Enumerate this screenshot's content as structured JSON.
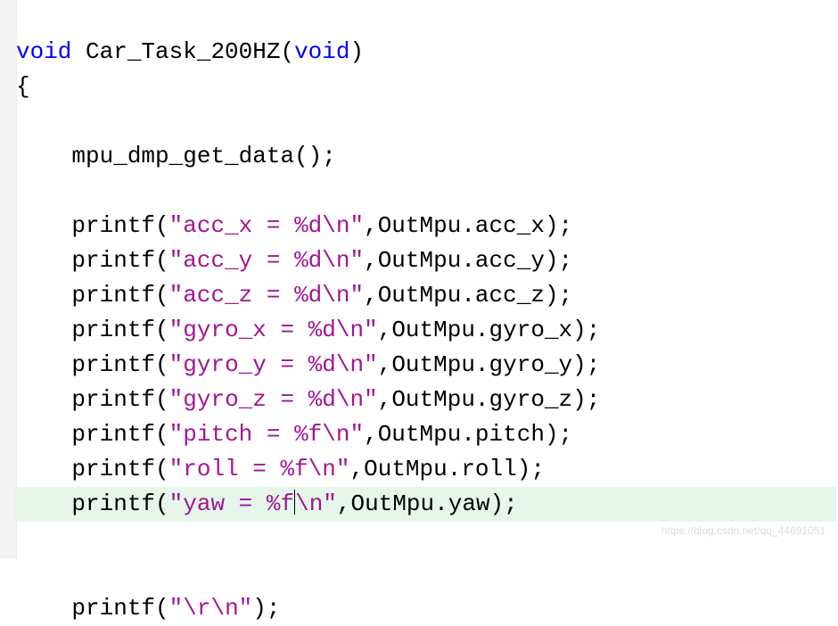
{
  "code": {
    "kw_void1": "void",
    "fn_name": " Car_Task_200HZ",
    "paren_open": "(",
    "kw_void2": "void",
    "paren_close": ")",
    "brace_open": "{",
    "blank": "",
    "indent": "    ",
    "call_mpu": "mpu_dmp_get_data();",
    "printf": "printf",
    "lp": "(",
    "rp": ")",
    "semi": ";",
    "comma": ",",
    "s_accx": "\"acc_x = %d\\n\"",
    "a_accx": "OutMpu.acc_x",
    "s_accy": "\"acc_y = %d\\n\"",
    "a_accy": "OutMpu.acc_y",
    "s_accz": "\"acc_z = %d\\n\"",
    "a_accz": "OutMpu.acc_z",
    "s_gyrox": "\"gyro_x = %d\\n\"",
    "a_gyrox": "OutMpu.gyro_x",
    "s_gyroy": "\"gyro_y = %d\\n\"",
    "a_gyroy": "OutMpu.gyro_y",
    "s_gyroz": "\"gyro_z = %d\\n\"",
    "a_gyroz": "OutMpu.gyro_z",
    "s_pitch": "\"pitch = %f\\n\"",
    "a_pitch": "OutMpu.pitch",
    "s_roll": "\"roll = %f\\n\"",
    "a_roll": "OutMpu.roll",
    "s_yaw1": "\"yaw = %f",
    "s_yaw2": "\\n\"",
    "a_yaw": "OutMpu.yaw",
    "s_rn": "\"\\r\\n\"",
    "last_tail": ";"
  },
  "watermark": "https://blog.csdn.net/qq_44691051"
}
